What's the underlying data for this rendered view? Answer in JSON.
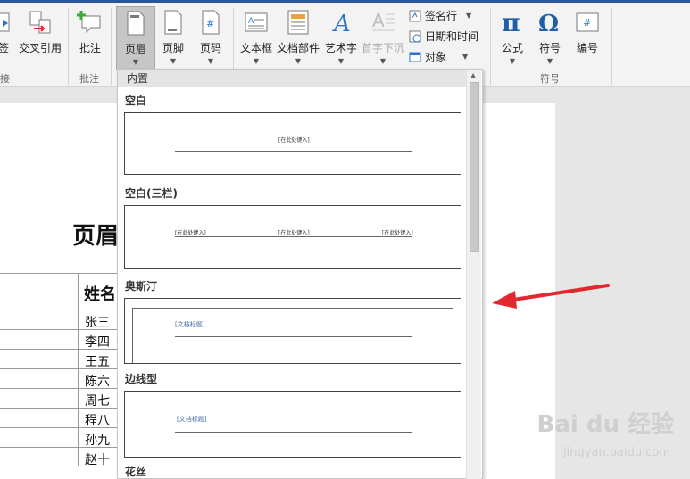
{
  "ribbon": {
    "buttons": {
      "bookmark": "签",
      "crossref": "交叉引用",
      "comment": "批注",
      "header": "页眉",
      "footer": "页脚",
      "pagenum": "页码",
      "textbox": "文本框",
      "quickparts": "文档部件",
      "wordart": "艺术字",
      "dropcap": "首字下沉",
      "equation": "公式",
      "symbol": "符号",
      "number": "编号"
    },
    "small": {
      "signature": "签名行",
      "datetime": "日期和时间",
      "object": "对象"
    },
    "groups": {
      "links": "接",
      "comments": "批注",
      "symbols": "符号"
    }
  },
  "menu": {
    "section": "内置",
    "items": [
      {
        "label": "空白",
        "placeholder": "[在此处键入]"
      },
      {
        "label": "空白(三栏)",
        "placeholders": [
          "[在此处键入]",
          "[在此处键入]",
          "[在此处键入]"
        ]
      },
      {
        "label": "奥斯汀",
        "placeholder": "[文档标题]"
      },
      {
        "label": "边线型",
        "placeholder": "[文档标题]"
      },
      {
        "label": "花丝"
      }
    ]
  },
  "doc": {
    "title": "页眉",
    "col_header": "姓名",
    "names": [
      "张三",
      "李四",
      "王五",
      "陈六",
      "周七",
      "程八",
      "孙九",
      "赵十"
    ]
  },
  "watermark": {
    "brand": "Bai du 经验",
    "url": "jingyan.baidu.com"
  },
  "colors": {
    "accent": "#2b579a",
    "arrow": "#e0282e",
    "wordart": "#2b73c6",
    "pi": "#1f5fa8"
  }
}
